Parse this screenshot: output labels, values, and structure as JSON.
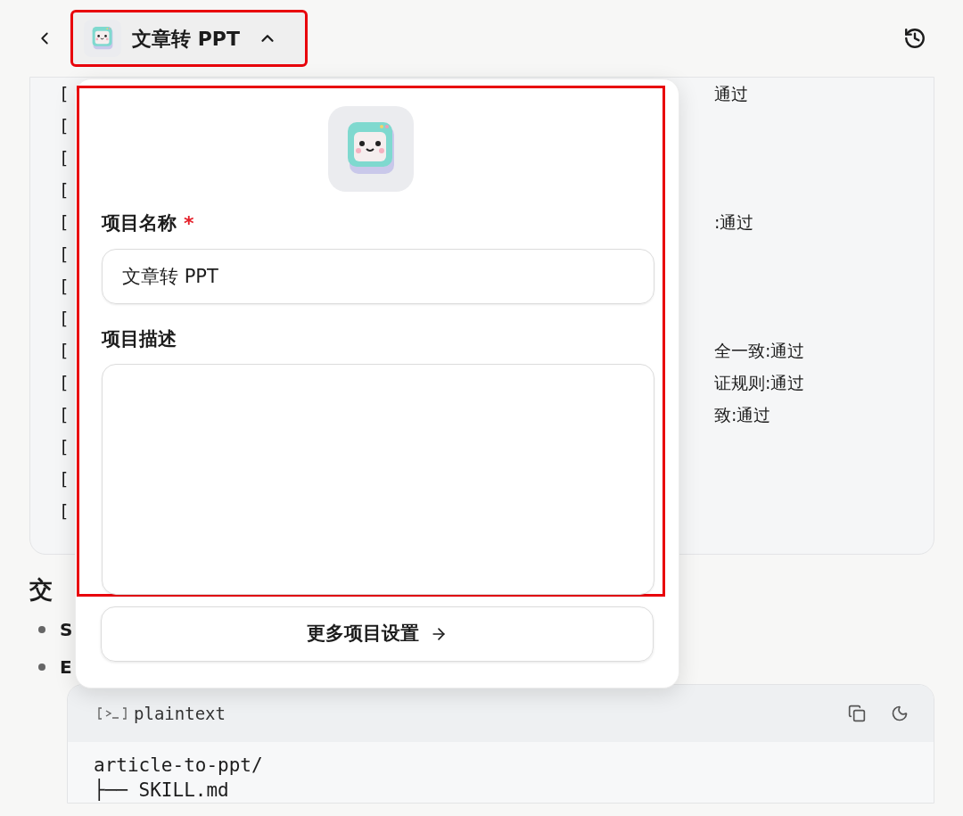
{
  "top_bar": {
    "project_button": {
      "label": "文章转 PPT",
      "expanded": true,
      "highlighted": true
    }
  },
  "background": {
    "card_lines": [
      {
        "left": "[",
        "right": "通过"
      },
      {
        "left": "["
      },
      {
        "left": "["
      },
      {
        "left": "["
      },
      {
        "left": "[",
        "right": ":通过"
      },
      {
        "left": "["
      },
      {
        "left": "["
      },
      {
        "left": "["
      },
      {
        "left": "[",
        "right": "全一致:通过"
      },
      {
        "left": "[",
        "right": "证规则:通过"
      },
      {
        "left": "[",
        "right": "致:通过"
      },
      {
        "left": "["
      },
      {
        "left": "["
      },
      {
        "left": "["
      }
    ],
    "heading": "交",
    "bullets": [
      "S",
      "E"
    ],
    "code_block": {
      "language": "plaintext",
      "lines": [
        "article-to-ppt/",
        "├── SKILL.md"
      ]
    }
  },
  "popup": {
    "form_highlighted": true,
    "name_label": "项目名称",
    "name_required": true,
    "required_mark": "*",
    "name_value": "文章转 PPT",
    "description_label": "项目描述",
    "more_button": "更多项目设置"
  }
}
